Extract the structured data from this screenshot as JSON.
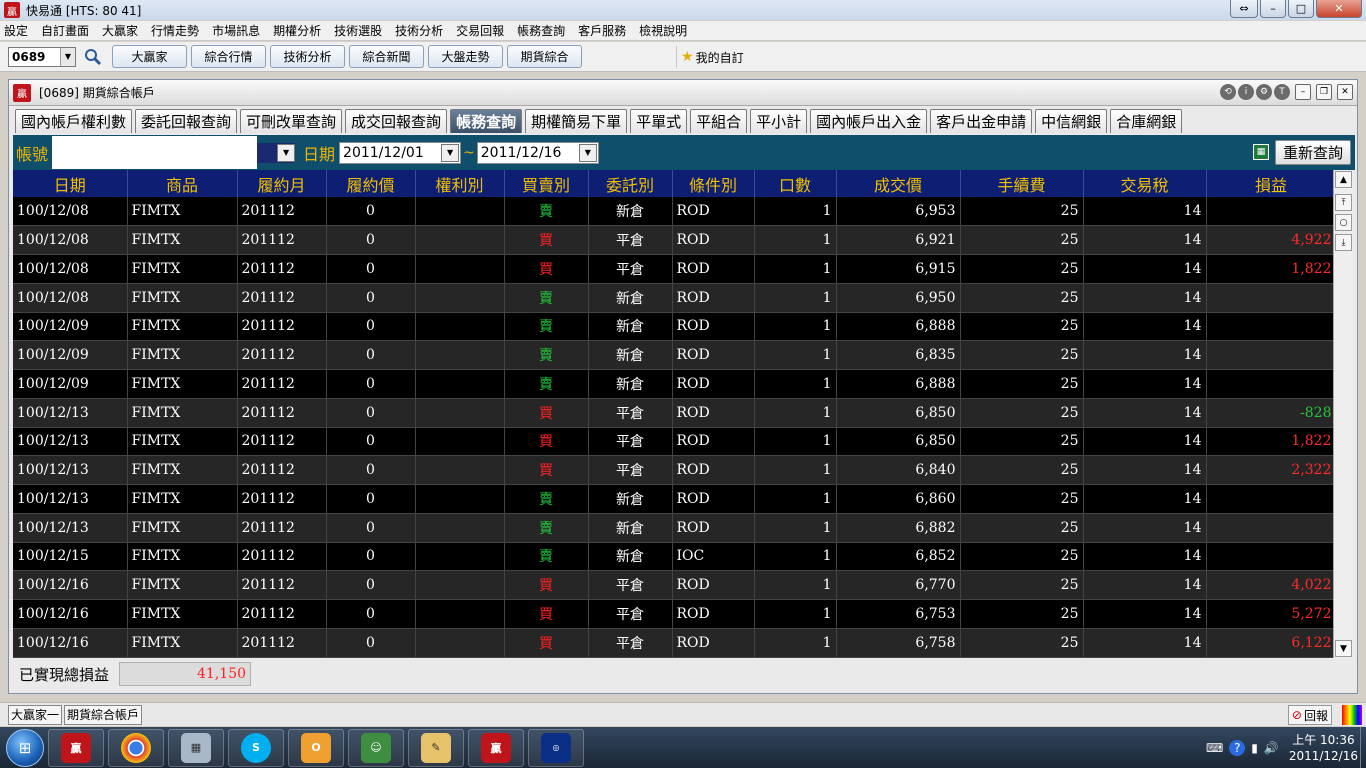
{
  "app": {
    "title": "快易通 [HTS: 80 41]"
  },
  "menu": [
    "設定",
    "自訂畫面",
    "大贏家",
    "行情走勢",
    "市場訊息",
    "期權分析",
    "技術選股",
    "技術分析",
    "交易回報",
    "帳務查詢",
    "客戶服務",
    "檢視說明"
  ],
  "toolbar": {
    "stock_code": "0689",
    "buttons": [
      "大贏家",
      "綜合行情",
      "技術分析",
      "綜合新聞",
      "大盤走勢",
      "期貨綜合"
    ],
    "favorites": "我的自訂"
  },
  "child": {
    "title": "[0689] 期貨綜合帳戶",
    "tabs": [
      "國內帳戶權利數",
      "委託回報查詢",
      "可刪改單查詢",
      "成交回報查詢",
      "帳務查詢",
      "期權簡易下單",
      "平單式",
      "平組合",
      "平小計",
      "國內帳戶出入金",
      "客戶出金申請",
      "中信網銀",
      "合庫網銀"
    ],
    "active_tab": "帳務查詢"
  },
  "filter": {
    "account_label": "帳號",
    "date_label": "日期",
    "date_from": "2011/12/01",
    "date_sep": "~",
    "date_to": "2011/12/16",
    "requery_label": "重新查詢"
  },
  "table": {
    "columns": [
      "日期",
      "商品",
      "履約月",
      "履約價",
      "權利別",
      "買賣別",
      "委託別",
      "條件別",
      "口數",
      "成交價",
      "手續費",
      "交易稅",
      "損益"
    ],
    "rows": [
      [
        "100/12/08",
        "FIMTX",
        "201112",
        "0",
        "",
        "賣",
        "新倉",
        "ROD",
        "1",
        "6,953",
        "25",
        "14",
        ""
      ],
      [
        "100/12/08",
        "FIMTX",
        "201112",
        "0",
        "",
        "買",
        "平倉",
        "ROD",
        "1",
        "6,921",
        "25",
        "14",
        "4,922"
      ],
      [
        "100/12/08",
        "FIMTX",
        "201112",
        "0",
        "",
        "買",
        "平倉",
        "ROD",
        "1",
        "6,915",
        "25",
        "14",
        "1,822"
      ],
      [
        "100/12/08",
        "FIMTX",
        "201112",
        "0",
        "",
        "賣",
        "新倉",
        "ROD",
        "1",
        "6,950",
        "25",
        "14",
        ""
      ],
      [
        "100/12/09",
        "FIMTX",
        "201112",
        "0",
        "",
        "賣",
        "新倉",
        "ROD",
        "1",
        "6,888",
        "25",
        "14",
        ""
      ],
      [
        "100/12/09",
        "FIMTX",
        "201112",
        "0",
        "",
        "賣",
        "新倉",
        "ROD",
        "1",
        "6,835",
        "25",
        "14",
        ""
      ],
      [
        "100/12/09",
        "FIMTX",
        "201112",
        "0",
        "",
        "賣",
        "新倉",
        "ROD",
        "1",
        "6,888",
        "25",
        "14",
        ""
      ],
      [
        "100/12/13",
        "FIMTX",
        "201112",
        "0",
        "",
        "買",
        "平倉",
        "ROD",
        "1",
        "6,850",
        "25",
        "14",
        "-828"
      ],
      [
        "100/12/13",
        "FIMTX",
        "201112",
        "0",
        "",
        "買",
        "平倉",
        "ROD",
        "1",
        "6,850",
        "25",
        "14",
        "1,822"
      ],
      [
        "100/12/13",
        "FIMTX",
        "201112",
        "0",
        "",
        "買",
        "平倉",
        "ROD",
        "1",
        "6,840",
        "25",
        "14",
        "2,322"
      ],
      [
        "100/12/13",
        "FIMTX",
        "201112",
        "0",
        "",
        "賣",
        "新倉",
        "ROD",
        "1",
        "6,860",
        "25",
        "14",
        ""
      ],
      [
        "100/12/13",
        "FIMTX",
        "201112",
        "0",
        "",
        "賣",
        "新倉",
        "ROD",
        "1",
        "6,882",
        "25",
        "14",
        ""
      ],
      [
        "100/12/15",
        "FIMTX",
        "201112",
        "0",
        "",
        "賣",
        "新倉",
        "IOC",
        "1",
        "6,852",
        "25",
        "14",
        ""
      ],
      [
        "100/12/16",
        "FIMTX",
        "201112",
        "0",
        "",
        "買",
        "平倉",
        "ROD",
        "1",
        "6,770",
        "25",
        "14",
        "4,022"
      ],
      [
        "100/12/16",
        "FIMTX",
        "201112",
        "0",
        "",
        "買",
        "平倉",
        "ROD",
        "1",
        "6,753",
        "25",
        "14",
        "5,272"
      ],
      [
        "100/12/16",
        "FIMTX",
        "201112",
        "0",
        "",
        "買",
        "平倉",
        "ROD",
        "1",
        "6,758",
        "25",
        "14",
        "6,122"
      ]
    ]
  },
  "summary": {
    "label": "已實現總損益",
    "value": "41,150"
  },
  "bottombar": {
    "tab1": "大贏家一",
    "tab2": "期貨綜合帳戶",
    "reply": "回報"
  },
  "taskbar": {
    "time": "上午 10:36",
    "date": "2011/12/16"
  },
  "colors": {
    "header_bg": "#0e1e72",
    "header_text": "#f0c000",
    "buy": "#ff2020",
    "sell": "#22c93b",
    "filter_bg": "#0f4f6b"
  }
}
